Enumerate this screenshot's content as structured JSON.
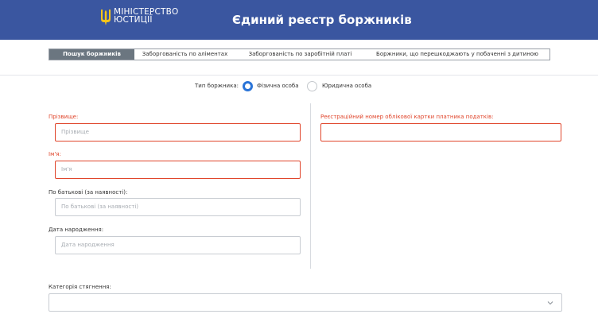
{
  "header": {
    "logo_line1": "МІНІСТЕРСТВО",
    "logo_line2": "ЮСТИЦІЇ",
    "title": "Єдиний реєстр боржників",
    "background": "#3a56a0"
  },
  "tabs": [
    {
      "label": "Пошук боржників",
      "active": true
    },
    {
      "label": "Заборгованість по аліментах",
      "active": false
    },
    {
      "label": "Заборгованість по заробітній платі",
      "active": false
    },
    {
      "label": "Боржники, що перешкоджають у побаченні з дитиною",
      "active": false
    }
  ],
  "debtor_type": {
    "label": "Тип боржника:",
    "options": [
      {
        "label": "Фізична особа",
        "selected": true
      },
      {
        "label": "Юридична особа",
        "selected": false
      }
    ]
  },
  "form": {
    "surname": {
      "label": "Прізвище:",
      "placeholder": "Прізвище",
      "value": ""
    },
    "name": {
      "label": "Ім'я:",
      "placeholder": "Ім'я",
      "value": ""
    },
    "patronymic": {
      "label": "По батькові (за наявності):",
      "placeholder": "По батькові (за наявності)",
      "value": ""
    },
    "birth_date": {
      "label": "Дата народження:",
      "placeholder": "Дата народження",
      "value": ""
    },
    "tax_number": {
      "label": "Реєстраційний номер облікової картки платника податків:",
      "placeholder": "",
      "value": ""
    },
    "category": {
      "label": "Категорія стягнення:",
      "value": ""
    }
  },
  "colors": {
    "accent": "#2a74d8",
    "error": "#e0452b",
    "active_tab": "#6b7680"
  }
}
